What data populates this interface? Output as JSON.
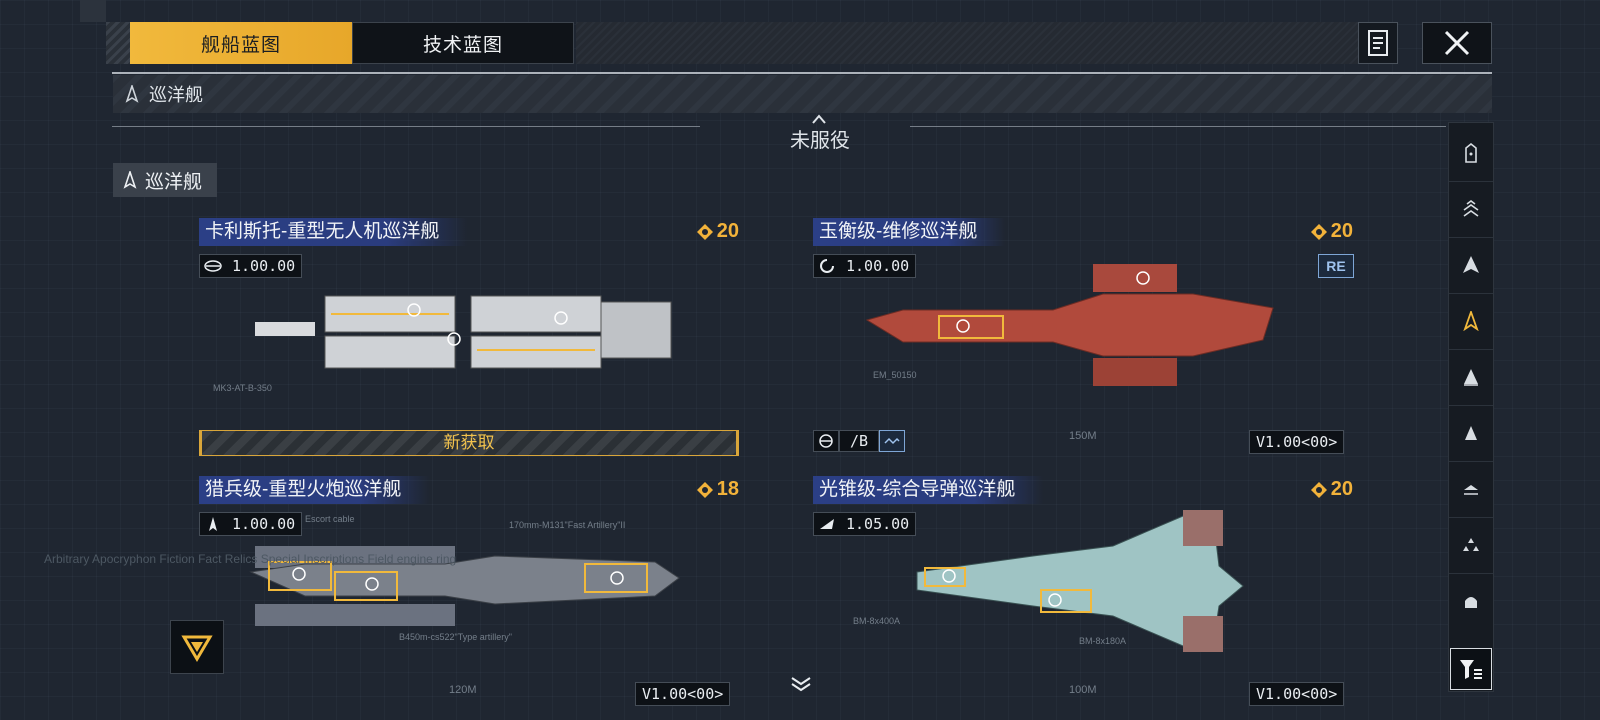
{
  "tabs": [
    {
      "label": "舰船蓝图",
      "active": true
    },
    {
      "label": "技术蓝图",
      "active": false
    }
  ],
  "category_bar": {
    "label": "巡洋舰",
    "icon": "cruiser-icon"
  },
  "section": {
    "title": "未服役"
  },
  "group": {
    "label": "巡洋舰"
  },
  "colors": {
    "accent": "#f1b93c",
    "title_bg": "#2b3f86",
    "ship_red": "#b14a3c",
    "ship_teal": "#9fc4c4"
  },
  "ships": [
    {
      "name": "卡利斯托-重型无人机巡洋舰",
      "cost": "20",
      "version": "1.00",
      "version_suffix": "00",
      "new_label": "新获取",
      "icon": "drone-carrier-icon",
      "annotations": [
        "MK3-AT-B-350"
      ]
    },
    {
      "name": "玉衡级-维修巡洋舰",
      "cost": "20",
      "version": "1.00",
      "version_suffix": "00",
      "tag": "RE",
      "indicator": "/B",
      "v_label": "V1.00<00>",
      "icon": "repair-icon",
      "annotations": [
        "EM_50150",
        "150M"
      ]
    },
    {
      "name": "猎兵级-重型火炮巡洋舰",
      "cost": "18",
      "version": "1.00",
      "version_suffix": "00",
      "v_label": "V1.00<00>",
      "icon": "artillery-icon",
      "annotations": [
        "Escort cable",
        "170mm-M131\"Fast Artillery\"II",
        "B450m-cs522\"Type artillery\"",
        "120M"
      ]
    },
    {
      "name": "光锥级-综合导弹巡洋舰",
      "cost": "20",
      "version": "1.05",
      "version_suffix": "00",
      "v_label": "V1.00<00>",
      "icon": "missile-icon",
      "annotations": [
        "BM-8x400A",
        "BM-8x180A",
        "100M"
      ]
    }
  ],
  "rail_icons": [
    "battleship-icon",
    "carrier-icon",
    "destroyer-icon",
    "cruiser-icon",
    "frigate-icon",
    "corvette-icon",
    "aux-icon",
    "fighter-icon",
    "station-icon"
  ],
  "left_faded_text": "Arbitrary Apocryphon Fiction Fact Relics Special Inscriptions Field engine ring"
}
